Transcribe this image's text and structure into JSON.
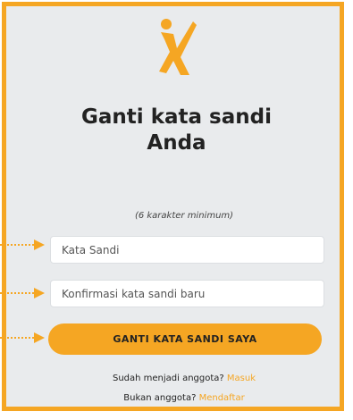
{
  "title_lines": [
    "Ganti kata sandi",
    "Anda"
  ],
  "password_hint": "(6 karakter minimum)",
  "fields": {
    "password_placeholder": "Kata Sandi",
    "confirm_placeholder": "Konfirmasi kata sandi baru"
  },
  "submit_label": "GANTI KATA SANDI SAYA",
  "footer": {
    "member_text": "Sudah menjadi anggota?",
    "login_link": "Masuk",
    "nonmember_text": "Bukan anggota?",
    "signup_link": "Mendaftar"
  },
  "colors": {
    "accent": "#f5a623",
    "panel_background": "#e9ebed"
  },
  "icons": {
    "logo": "leaping-figure-logo-icon",
    "pointer": "dotted-arrow-icon"
  }
}
